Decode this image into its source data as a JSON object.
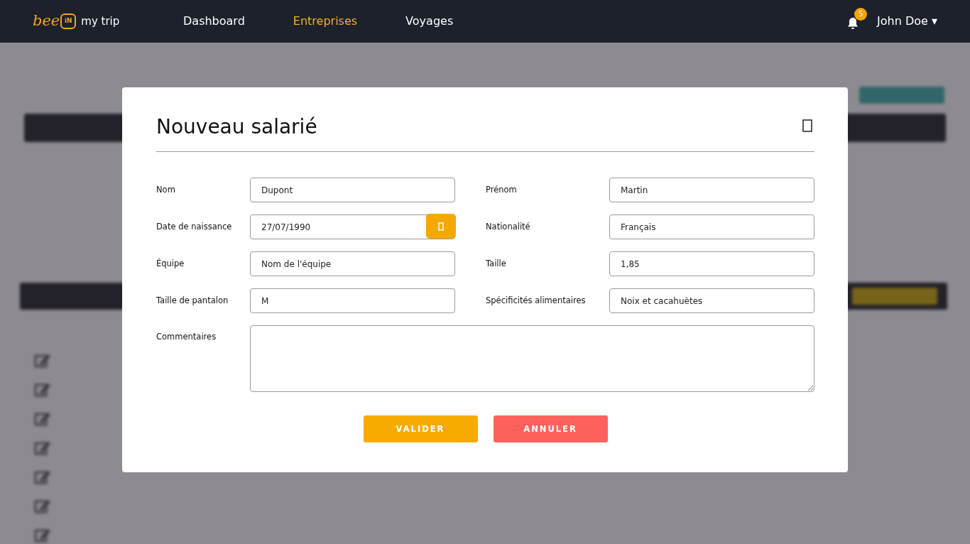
{
  "navbar": {
    "logo": {
      "script": "bee",
      "badge": "iN",
      "text": "my trip"
    },
    "links": [
      {
        "label": "Dashboard",
        "selected": false
      },
      {
        "label": "Entreprises",
        "selected": true
      },
      {
        "label": "Voyages",
        "selected": false
      }
    ],
    "notifications": "5",
    "user": "John Doe",
    "caret": "▾"
  },
  "modal": {
    "title": "Nouveau salarié",
    "fields": [
      {
        "label": "Nom",
        "value": "Dupont",
        "kind": "text"
      },
      {
        "label": "Prénom",
        "value": "Martin",
        "kind": "text"
      },
      {
        "label": "Date de naissance",
        "value": "27/07/1990",
        "kind": "date"
      },
      {
        "label": "Nationalité",
        "value": "Français",
        "kind": "text"
      },
      {
        "label": "Équipe",
        "value": "Nom de l'équipe",
        "kind": "text"
      },
      {
        "label": "Taille",
        "value": "1,85",
        "kind": "text"
      },
      {
        "label": "Taille de pantalon",
        "value": "M",
        "kind": "text"
      },
      {
        "label": "Spécificités alimentaires",
        "value": "Noix et cacahuètes",
        "kind": "text"
      }
    ],
    "comments": {
      "label": "Commentaires"
    },
    "buttons": [
      {
        "label": "VALIDER",
        "kind": "primary"
      },
      {
        "label": "ANNULER",
        "kind": "danger"
      }
    ]
  }
}
